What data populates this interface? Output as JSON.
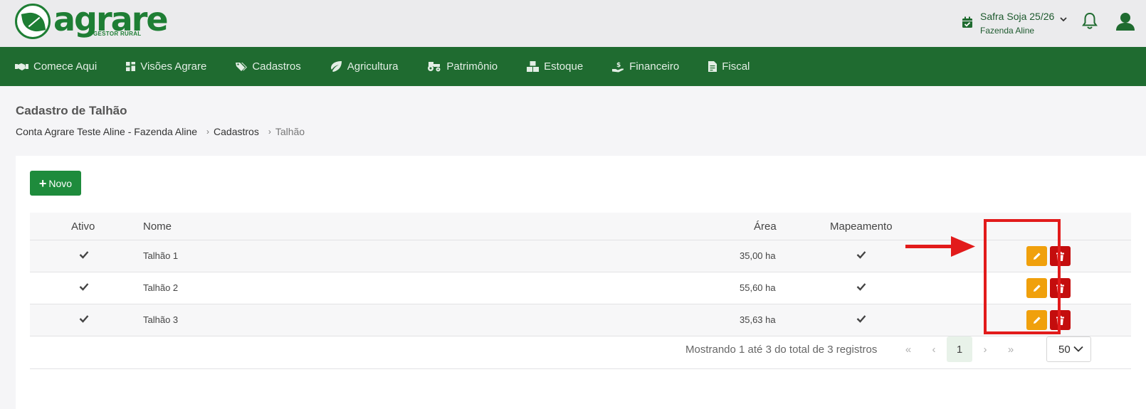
{
  "header": {
    "logo_text": "agrare",
    "logo_subtitle": "GESTOR RURAL",
    "season": "Safra Soja 25/26",
    "farm": "Fazenda Aline",
    "icons": [
      "calendar-check-icon",
      "chevron-down-icon",
      "bell-icon",
      "user-icon"
    ]
  },
  "nav": {
    "items": [
      {
        "label": "Comece Aqui",
        "icon": "handshake-icon"
      },
      {
        "label": "Visões Agrare",
        "icon": "dashboard-icon"
      },
      {
        "label": "Cadastros",
        "icon": "tags-icon"
      },
      {
        "label": "Agricultura",
        "icon": "leaf-icon"
      },
      {
        "label": "Patrimônio",
        "icon": "tractor-icon"
      },
      {
        "label": "Estoque",
        "icon": "boxes-icon"
      },
      {
        "label": "Financeiro",
        "icon": "hand-dollar-icon"
      },
      {
        "label": "Fiscal",
        "icon": "invoice-icon"
      }
    ]
  },
  "page": {
    "title": "Cadastro de Talhão",
    "breadcrumb": [
      "Conta Agrare Teste Aline - Fazenda Aline",
      "Cadastros",
      "Talhão"
    ]
  },
  "toolbar": {
    "new_label": "Novo"
  },
  "table": {
    "columns": [
      "Ativo",
      "Nome",
      "Área",
      "Mapeamento"
    ],
    "rows": [
      {
        "ativo": true,
        "nome": "Talhão 1",
        "area": "35,00 ha",
        "mapeamento": true
      },
      {
        "ativo": true,
        "nome": "Talhão 2",
        "area": "55,60 ha",
        "mapeamento": true
      },
      {
        "ativo": true,
        "nome": "Talhão 3",
        "area": "35,63 ha",
        "mapeamento": true
      }
    ]
  },
  "pagination": {
    "info": "Mostrando 1 até 3 do total de 3 registros",
    "first": "«",
    "prev": "‹",
    "current_page": "1",
    "next": "›",
    "last": "»",
    "per_page": "50"
  },
  "colors": {
    "brand_green": "#1f6b30",
    "button_green": "#1e8b3c",
    "edit_orange": "#f0a00c",
    "delete_red": "#c40d0d",
    "annotation_red": "#e21b1b"
  }
}
